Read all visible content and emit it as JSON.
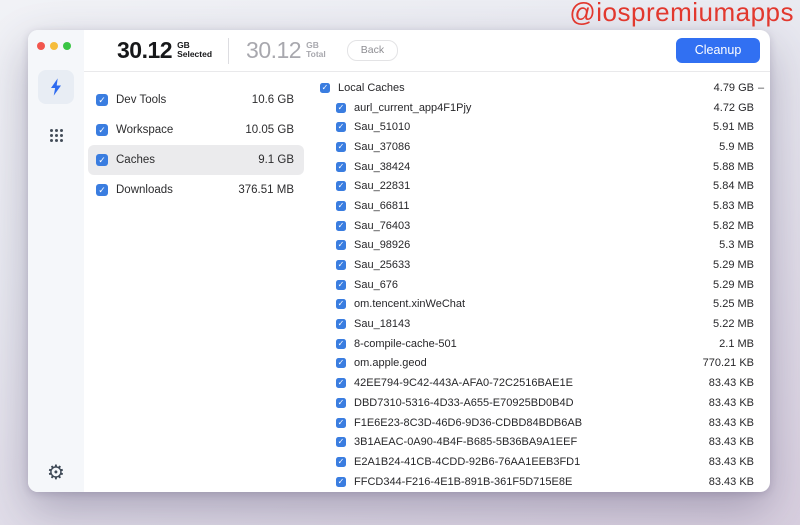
{
  "watermark": "@iospremiumapps",
  "colors": {
    "accent_blue": "#3170f2",
    "checkbox_blue": "#3a7de0",
    "watermark_red": "#e2382e",
    "selected_row_bg": "#ebebed",
    "sidebar_bg": "#f5f7fa"
  },
  "header": {
    "selected": {
      "value": "30.12",
      "unit": "GB",
      "label": "Selected"
    },
    "total": {
      "value": "30.12",
      "unit": "GB",
      "label": "Total"
    },
    "back_label": "Back",
    "cleanup_label": "Cleanup"
  },
  "sidebar": {
    "icons": [
      "bolt-icon",
      "grid-icon",
      "gear-icon"
    ],
    "gear_glyph": "⚙"
  },
  "left_panel": {
    "categories": [
      {
        "label": "Dev Tools",
        "size": "10.6 GB",
        "checked": true,
        "selected": false
      },
      {
        "label": "Workspace",
        "size": "10.05 GB",
        "checked": true,
        "selected": false
      },
      {
        "label": "Caches",
        "size": "9.1 GB",
        "checked": true,
        "selected": true
      },
      {
        "label": "Downloads",
        "size": "376.51 MB",
        "checked": true,
        "selected": false
      }
    ]
  },
  "file_panel": {
    "group": {
      "label": "Local Caches",
      "size": "4.79 GB",
      "collapse_indicator": "–",
      "checked": true
    },
    "items": [
      {
        "label": "aurl_current_app4F1Pjy",
        "size": "4.72 GB",
        "checked": true
      },
      {
        "label": "Sau_51010",
        "size": "5.91 MB",
        "checked": true
      },
      {
        "label": "Sau_37086",
        "size": "5.9 MB",
        "checked": true
      },
      {
        "label": "Sau_38424",
        "size": "5.88 MB",
        "checked": true
      },
      {
        "label": "Sau_22831",
        "size": "5.84 MB",
        "checked": true
      },
      {
        "label": "Sau_66811",
        "size": "5.83 MB",
        "checked": true
      },
      {
        "label": "Sau_76403",
        "size": "5.82 MB",
        "checked": true
      },
      {
        "label": "Sau_98926",
        "size": "5.3 MB",
        "checked": true
      },
      {
        "label": "Sau_25633",
        "size": "5.29 MB",
        "checked": true
      },
      {
        "label": "Sau_676",
        "size": "5.29 MB",
        "checked": true
      },
      {
        "label": "om.tencent.xinWeChat",
        "size": "5.25 MB",
        "checked": true
      },
      {
        "label": "Sau_18143",
        "size": "5.22 MB",
        "checked": true
      },
      {
        "label": "8-compile-cache-501",
        "size": "2.1 MB",
        "checked": true
      },
      {
        "label": "om.apple.geod",
        "size": "770.21 KB",
        "checked": true
      },
      {
        "label": "42EE794-9C42-443A-AFA0-72C2516BAE1E",
        "size": "83.43 KB",
        "checked": true
      },
      {
        "label": "DBD7310-5316-4D33-A655-E70925BD0B4D",
        "size": "83.43 KB",
        "checked": true
      },
      {
        "label": "F1E6E23-8C3D-46D6-9D36-CDBD84BDB6AB",
        "size": "83.43 KB",
        "checked": true
      },
      {
        "label": "3B1AEAC-0A90-4B4F-B685-5B36BA9A1EEF",
        "size": "83.43 KB",
        "checked": true
      },
      {
        "label": "E2A1B24-41CB-4CDD-92B6-76AA1EEB3FD1",
        "size": "83.43 KB",
        "checked": true
      },
      {
        "label": "FFCD344-F216-4E1B-891B-361F5D715E8E",
        "size": "83.43 KB",
        "checked": true
      }
    ]
  }
}
